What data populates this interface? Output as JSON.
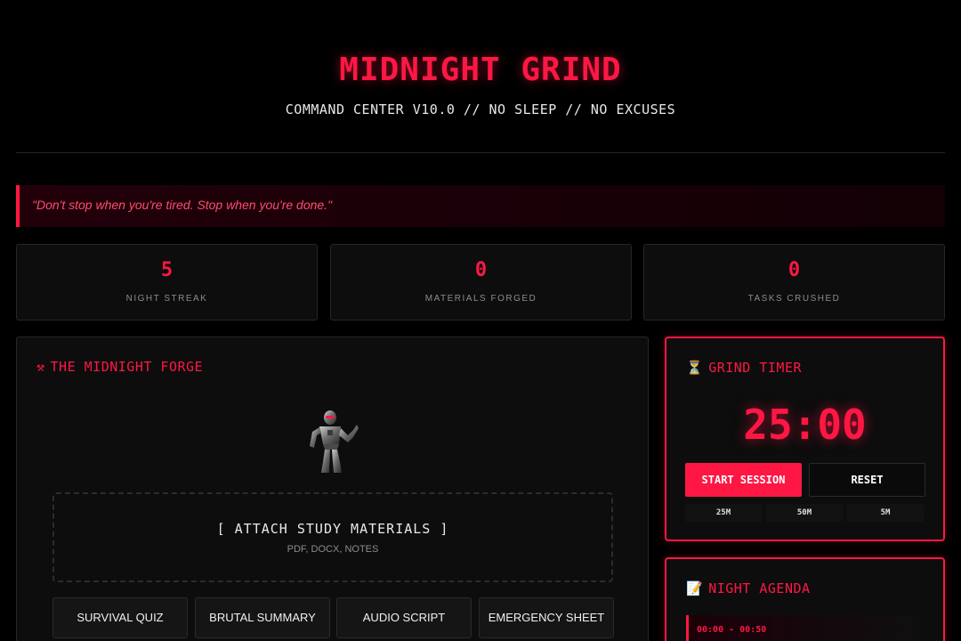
{
  "header": {
    "title": "MIDNIGHT GRIND",
    "subtitle": "COMMAND CENTER V10.0 // NO SLEEP // NO EXCUSES"
  },
  "quote": "\"Don't stop when you're tired. Stop when you're done.\"",
  "stats": [
    {
      "value": "5",
      "label": "NIGHT STREAK"
    },
    {
      "value": "0",
      "label": "MATERIALS FORGED"
    },
    {
      "value": "0",
      "label": "TASKS CRUSHED"
    }
  ],
  "forge": {
    "icon": "hammer-pick-icon",
    "title": "THE MIDNIGHT FORGE",
    "mascot": "robot-icon",
    "dropzone": {
      "title": "[ ATTACH STUDY MATERIALS ]",
      "subtitle": "PDF, DOCX, NOTES"
    },
    "actions": [
      "SURVIVAL QUIZ",
      "BRUTAL SUMMARY",
      "AUDIO SCRIPT",
      "EMERGENCY SHEET"
    ]
  },
  "timer": {
    "icon": "hourglass-icon",
    "title": "GRIND TIMER",
    "display": "25:00",
    "start_label": "START SESSION",
    "reset_label": "RESET",
    "presets": [
      "25M",
      "50M",
      "5M"
    ]
  },
  "agenda": {
    "icon": "memo-icon",
    "title": "NIGHT AGENDA",
    "items": [
      {
        "time": "00:00 - 00:50"
      }
    ]
  },
  "colors": {
    "accent": "#ff1744",
    "background": "#000000",
    "panel": "#0d0d0d"
  }
}
